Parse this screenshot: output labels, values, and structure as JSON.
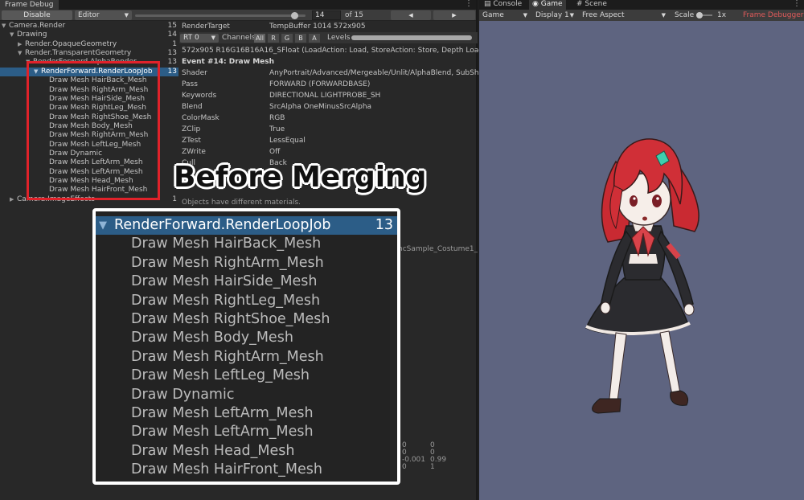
{
  "frame_debug": {
    "tab_title": "Frame Debug",
    "menu_icon": "kebab-menu-icon",
    "toolbar": {
      "disable_label": "Disable",
      "target_selected": "Editor",
      "event_value": "14",
      "of_total": "of 15",
      "prev_icon": "◀",
      "next_icon": "▶"
    },
    "tree": [
      {
        "label": "Camera.Render",
        "count": "15",
        "expanded": true
      },
      {
        "label": "Drawing",
        "count": "14",
        "expanded": true
      },
      {
        "label": "Render.OpaqueGeometry",
        "count": "1",
        "expanded": false
      },
      {
        "label": "Render.TransparentGeometry",
        "count": "13",
        "expanded": true
      },
      {
        "label": "RenderForward.AlphaRender",
        "count": "13",
        "expanded": true
      },
      {
        "label": "RenderForward.RenderLoopJob",
        "count": "13",
        "expanded": true,
        "selected": true
      },
      {
        "label": "Draw Mesh HairBack_Mesh",
        "count": ""
      },
      {
        "label": "Draw Mesh RightArm_Mesh",
        "count": ""
      },
      {
        "label": "Draw Mesh HairSide_Mesh",
        "count": ""
      },
      {
        "label": "Draw Mesh RightLeg_Mesh",
        "count": ""
      },
      {
        "label": "Draw Mesh RightShoe_Mesh",
        "count": ""
      },
      {
        "label": "Draw Mesh Body_Mesh",
        "count": ""
      },
      {
        "label": "Draw Mesh RightArm_Mesh",
        "count": ""
      },
      {
        "label": "Draw Mesh LeftLeg_Mesh",
        "count": ""
      },
      {
        "label": "Draw Dynamic",
        "count": ""
      },
      {
        "label": "Draw Mesh LeftArm_Mesh",
        "count": ""
      },
      {
        "label": "Draw Mesh LeftArm_Mesh",
        "count": ""
      },
      {
        "label": "Draw Mesh Head_Mesh",
        "count": ""
      },
      {
        "label": "Draw Mesh HairFront_Mesh",
        "count": ""
      },
      {
        "label": "Camera.ImageEffects",
        "count": "1",
        "expanded": false
      }
    ],
    "details": {
      "render_target_label": "RenderTarget",
      "render_target_value": "TempBuffer 1014 572x905",
      "rt_selected": "RT 0",
      "channels_label": "Channels",
      "channels": [
        "All",
        "R",
        "G",
        "B",
        "A"
      ],
      "levels_label": "Levels",
      "format_line": "572x905 R16G16B16A16_SFloat (LoadAction: Load, StoreAction: Store, Depth LoadAction: L",
      "event_title": "Event #14: Draw Mesh",
      "properties": [
        {
          "key": "Shader",
          "value": "AnyPortrait/Advanced/Mergeable/Unlit/AlphaBlend, SubShader #"
        },
        {
          "key": "Pass",
          "value": "FORWARD (FORWARDBASE)"
        },
        {
          "key": "Keywords",
          "value": "DIRECTIONAL LIGHTPROBE_SH"
        },
        {
          "key": "Blend",
          "value": "SrcAlpha OneMinusSrcAlpha"
        },
        {
          "key": "ColorMask",
          "value": "RGB"
        },
        {
          "key": "ZClip",
          "value": "True"
        },
        {
          "key": "ZTest",
          "value": "LessEqual"
        },
        {
          "key": "ZWrite",
          "value": "Off"
        },
        {
          "key": "Cull",
          "value": "Back"
        }
      ],
      "batch_note": "Objects have different materials.",
      "sample_fragment": "ncSample_Costume1_0",
      "matrix_rows": [
        [
          "0",
          "0"
        ],
        [
          "0",
          "0"
        ],
        [
          "-0.001",
          "0.99"
        ],
        [
          "0",
          "1"
        ]
      ]
    }
  },
  "game_view": {
    "tabs": [
      {
        "label": "Console",
        "icon": "console-icon"
      },
      {
        "label": "Game",
        "icon": "gamepad-icon"
      },
      {
        "label": "Scene",
        "icon": "scene-grid-icon"
      }
    ],
    "toolbar": {
      "view_selected": "Game",
      "display_selected": "Display 1",
      "aspect_selected": "Free Aspect",
      "scale_label": "Scale",
      "scale_value": "1x",
      "frame_debugger_label": "Frame Debugger O"
    },
    "background_color": "#5e6480"
  },
  "overlay": {
    "title": "Before Merging",
    "zoom_rows": [
      {
        "label": "RenderForward.RenderLoopJob",
        "count": "13",
        "selected": true
      },
      {
        "label": "Draw Mesh HairBack_Mesh"
      },
      {
        "label": "Draw Mesh RightArm_Mesh"
      },
      {
        "label": "Draw Mesh HairSide_Mesh"
      },
      {
        "label": "Draw Mesh RightLeg_Mesh"
      },
      {
        "label": "Draw Mesh RightShoe_Mesh"
      },
      {
        "label": "Draw Mesh Body_Mesh"
      },
      {
        "label": "Draw Mesh RightArm_Mesh"
      },
      {
        "label": "Draw Mesh LeftLeg_Mesh"
      },
      {
        "label": "Draw Dynamic"
      },
      {
        "label": "Draw Mesh LeftArm_Mesh"
      },
      {
        "label": "Draw Mesh LeftArm_Mesh"
      },
      {
        "label": "Draw Mesh Head_Mesh"
      },
      {
        "label": "Draw Mesh HairFront_Mesh"
      }
    ]
  }
}
